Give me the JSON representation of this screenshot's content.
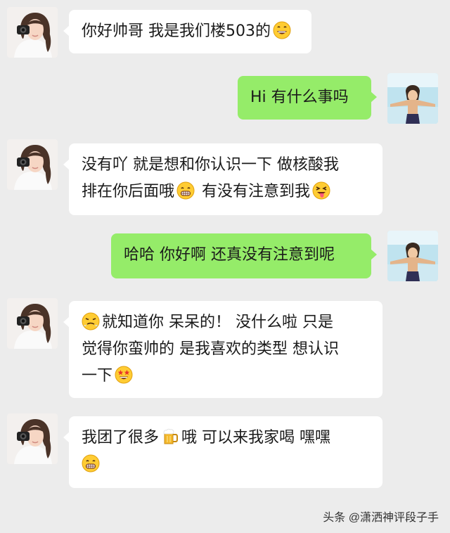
{
  "messages": [
    {
      "side": "in",
      "lines": [
        "你好帅哥 我是我们楼503的"
      ],
      "emoji": "grin-face"
    },
    {
      "side": "out",
      "lines": [
        "Hi 有什么事吗"
      ]
    },
    {
      "side": "in",
      "lines": [
        "没有吖 就是想和你认识一下 做核酸我",
        "排在你后面哦",
        "有没有注意到我"
      ],
      "emoji": [
        "grimace-face",
        "tongue-out-face"
      ]
    },
    {
      "side": "out",
      "lines": [
        "哈哈 你好啊 还真没有注意到呢"
      ]
    },
    {
      "side": "in",
      "lines": [
        "就知道你 呆呆的！ 没什么啦 只是",
        "觉得你蛮帅的 是我喜欢的类型 想认识",
        "一下"
      ],
      "emoji": [
        "steam-face",
        "star-eyes-face"
      ]
    },
    {
      "side": "in",
      "lines": [
        "我团了很多",
        "哦 可以来我家喝 嘿嘿"
      ],
      "emoji": [
        "beer-mug",
        "grimace-face"
      ]
    }
  ],
  "watermark": "头条 @潇洒神评段子手",
  "colors": {
    "background": "#ececec",
    "incoming_bubble": "#ffffff",
    "outgoing_bubble": "#95ec69"
  },
  "icons": {
    "contact_avatar": "girl-with-camera-avatar",
    "own_avatar": "anime-character-avatar"
  }
}
